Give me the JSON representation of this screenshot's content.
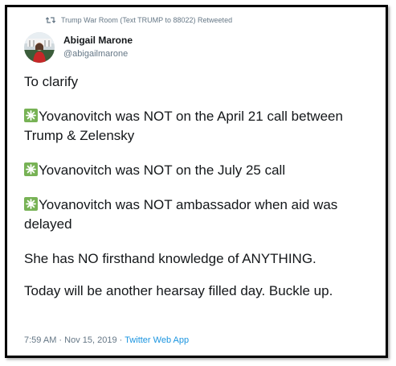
{
  "retweet": {
    "text": "Trump War Room (Text TRUMP to 88022) Retweeted",
    "icon": "retweet-icon"
  },
  "author": {
    "display_name": "Abigail Marone",
    "handle": "@abigailmarone",
    "avatar_icon": "avatar"
  },
  "tweet": {
    "lines": [
      "To clarify",
      "Yovanovitch was NOT on the April 21 call between Trump & Zelensky",
      "Yovanovitch was NOT on the July 25 call",
      "Yovanovitch was NOT ambassador when aid was delayed",
      "She has NO firsthand knowledge of ANYTHING.",
      "Today will be another hearsay filled day. Buckle up."
    ],
    "emoji": "sparkle-icon"
  },
  "meta": {
    "time": "7:59 AM",
    "date": "Nov 15, 2019",
    "separator": "·",
    "app": "Twitter Web App"
  },
  "colors": {
    "text": "#14171a",
    "secondary": "#657786",
    "link": "#1b95e0",
    "sparkle_bg": "#77b255"
  }
}
